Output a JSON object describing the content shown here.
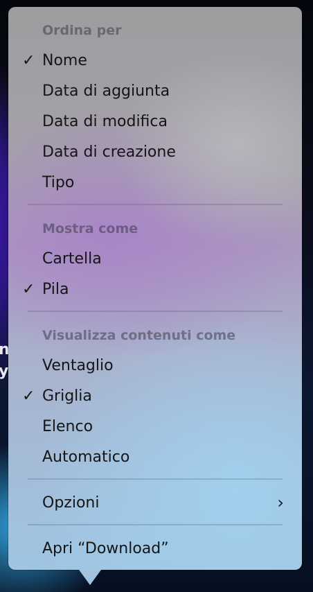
{
  "background": {
    "edge_text_1": "n",
    "edge_text_2": "y"
  },
  "menu": {
    "sections": [
      {
        "header": "Ordina per",
        "items": [
          {
            "label": "Nome",
            "checked": true
          },
          {
            "label": "Data di aggiunta",
            "checked": false
          },
          {
            "label": "Data di modifica",
            "checked": false
          },
          {
            "label": "Data di creazione",
            "checked": false
          },
          {
            "label": "Tipo",
            "checked": false
          }
        ]
      },
      {
        "header": "Mostra come",
        "items": [
          {
            "label": "Cartella",
            "checked": false
          },
          {
            "label": "Pila",
            "checked": true
          }
        ]
      },
      {
        "header": "Visualizza contenuti come",
        "items": [
          {
            "label": "Ventaglio",
            "checked": false
          },
          {
            "label": "Griglia",
            "checked": true
          },
          {
            "label": "Elenco",
            "checked": false
          },
          {
            "label": "Automatico",
            "checked": false
          }
        ]
      }
    ],
    "options_label": "Opzioni",
    "open_label": "Apri “Download”",
    "check_glyph": "✓",
    "submenu_glyph": "›"
  }
}
